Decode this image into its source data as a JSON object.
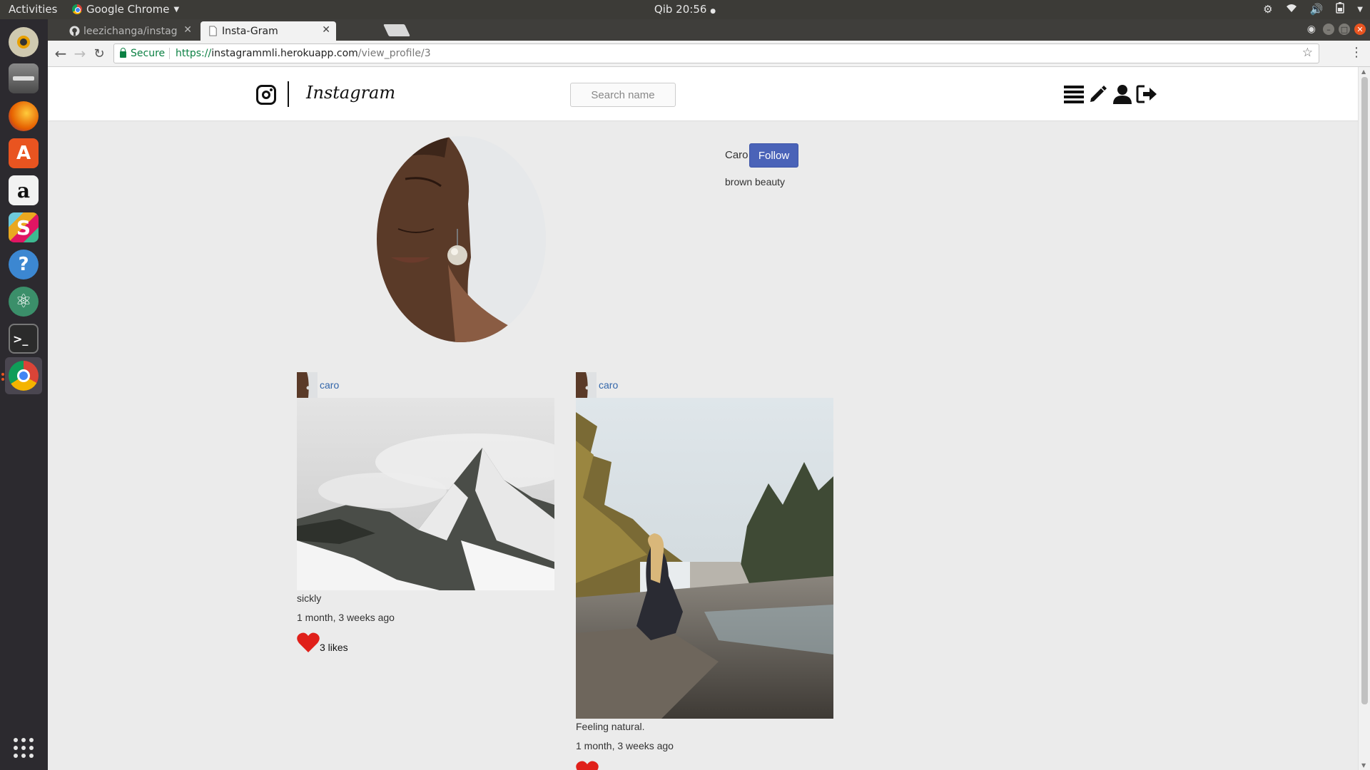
{
  "os": {
    "activities": "Activities",
    "app_name": "Google Chrome",
    "clock": "Qib 20:56"
  },
  "browser": {
    "tabs": [
      {
        "title": "leezichanga/instag",
        "active": false
      },
      {
        "title": "Insta-Gram",
        "active": true
      }
    ],
    "secure_label": "Secure",
    "url_protocol": "https://",
    "url_host": "instagrammli.herokuapp.com",
    "url_path": "/view_profile/3"
  },
  "site": {
    "brand": "Instagram",
    "search_placeholder": "Search name",
    "nav_icons": [
      "list-icon",
      "pencil-icon",
      "user-icon",
      "logout-icon"
    ]
  },
  "profile": {
    "username": "Caro",
    "follow_label": "Follow",
    "bio": "brown beauty"
  },
  "posts": [
    {
      "user": "caro",
      "caption": "sickly",
      "time": "1 month, 3 weeks ago",
      "likes": "3 likes",
      "image": "snowy-mountain-photo"
    },
    {
      "user": "caro",
      "caption": "Feeling natural.",
      "time": "1 month, 3 weeks ago",
      "likes": "",
      "image": "waterfall-woman-photo"
    }
  ],
  "colors": {
    "follow_button": "#4a63b8",
    "heart": "#e0201a",
    "link": "#3366aa"
  }
}
